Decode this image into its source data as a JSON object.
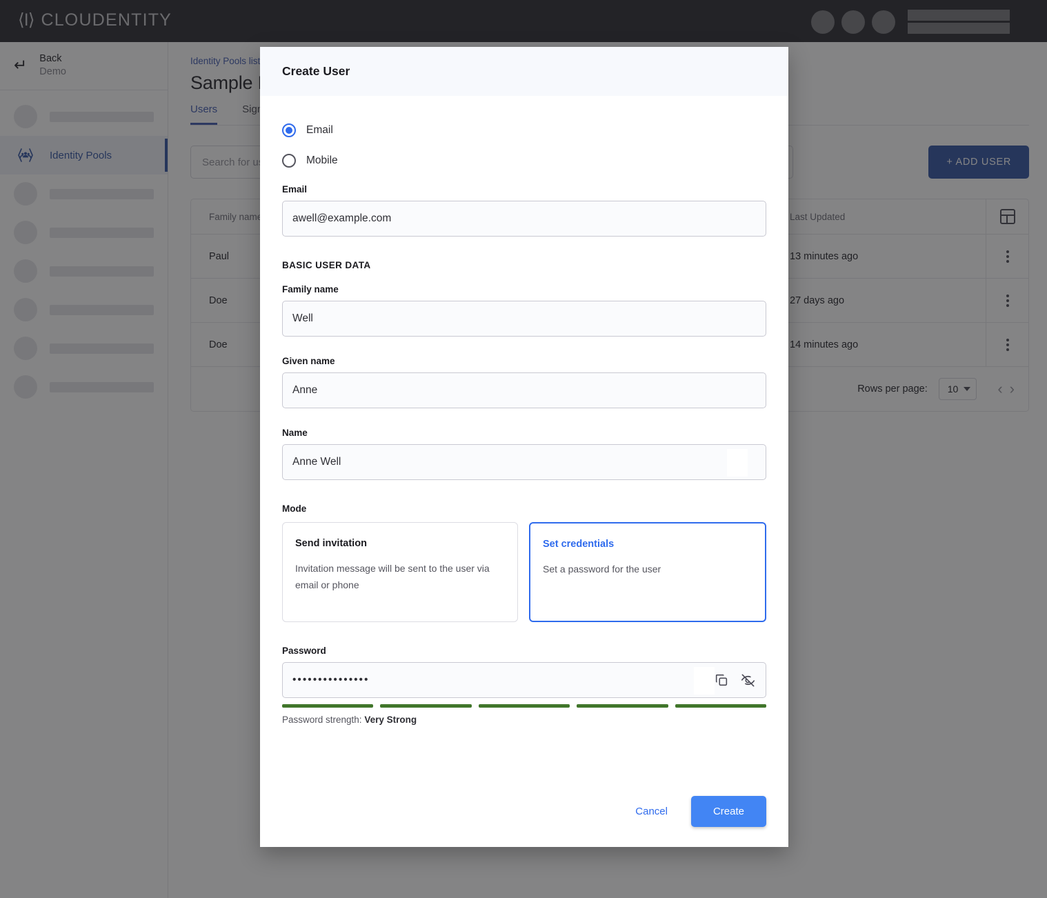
{
  "topbar": {
    "logo_mark": "⟨I⟩",
    "logo_text": "CLOUDENTITY"
  },
  "sidebar": {
    "back_label": "Back",
    "back_sub": "Demo",
    "active_item": "Identity Pools",
    "skeleton_items": 7
  },
  "page": {
    "breadcrumb": "Identity Pools list",
    "title": "Sample Pool",
    "tabs": [
      {
        "label": "Users",
        "selected": true
      },
      {
        "label": "Signup",
        "selected": false
      }
    ],
    "search_placeholder": "Search for users",
    "add_user_label": "+ ADD USER",
    "table": {
      "columns": [
        "Family name",
        "Last Updated"
      ],
      "rows": [
        {
          "family_name": "Paul",
          "last_updated": "13 minutes ago"
        },
        {
          "family_name": "Doe",
          "last_updated": "27 days ago"
        },
        {
          "family_name": "Doe",
          "last_updated": "14 minutes ago"
        }
      ],
      "rows_per_page_label": "Rows per page:",
      "rows_per_page_value": "10"
    }
  },
  "dialog": {
    "title": "Create User",
    "identifier_options": [
      {
        "label": "Email",
        "selected": true
      },
      {
        "label": "Mobile",
        "selected": false
      }
    ],
    "email": {
      "label": "Email",
      "value": "awell@example.com"
    },
    "basic_section_label": "BASIC USER DATA",
    "family_name": {
      "label": "Family name",
      "value": "Well"
    },
    "given_name": {
      "label": "Given name",
      "value": "Anne"
    },
    "name": {
      "label": "Name",
      "value": "Anne Well"
    },
    "mode": {
      "label": "Mode",
      "cards": [
        {
          "title": "Send invitation",
          "desc": "Invitation message will be sent to the user via email or phone",
          "selected": false
        },
        {
          "title": "Set credentials",
          "desc": "Set a password for the user",
          "selected": true
        }
      ]
    },
    "password": {
      "label": "Password",
      "value": "•••••••••••••••",
      "strength_prefix": "Password strength: ",
      "strength_value": "Very Strong",
      "strength_filled": 5,
      "strength_total": 5,
      "strength_color": "#41762b"
    },
    "cancel_label": "Cancel",
    "create_label": "Create"
  },
  "colors": {
    "accent_blue": "#2f6bed",
    "brand_blue": "#3b5ca8",
    "create_button": "#4285f4",
    "strength_green": "#41762b",
    "topbar": "#36363b"
  }
}
